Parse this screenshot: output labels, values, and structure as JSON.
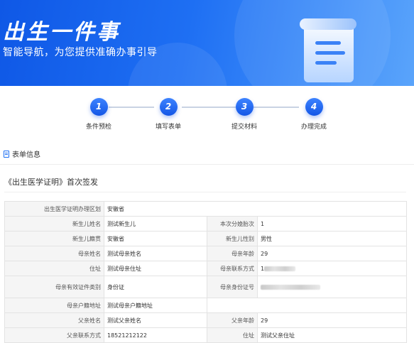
{
  "banner": {
    "title": "出生一件事",
    "subtitle": "智能导航，为您提供准确办事引导"
  },
  "steps": [
    {
      "num": "1",
      "label": "条件预检"
    },
    {
      "num": "2",
      "label": "填写表单"
    },
    {
      "num": "3",
      "label": "提交材料"
    },
    {
      "num": "4",
      "label": "办理完成"
    }
  ],
  "section": {
    "title": "表单信息",
    "form_title": "《出生医学证明》首次签发"
  },
  "table": {
    "region_label": "出生医学证明办理区划",
    "region_value": "安徽省",
    "newborn_name_label": "新生儿姓名",
    "newborn_name": "测试新生儿",
    "birth_order_label": "本次分娩胎次",
    "birth_order": "1",
    "newborn_origin_label": "新生儿籍贯",
    "newborn_origin": "安徽省",
    "newborn_gender_label": "新生儿性别",
    "newborn_gender": "男性",
    "mother_name_label": "母亲姓名",
    "mother_name": "测试母亲姓名",
    "mother_age_label": "母亲年龄",
    "mother_age": "29",
    "address_label": "住址",
    "address": "测试母亲住址",
    "mother_contact_label": "母亲联系方式",
    "mother_contact_visible": "1",
    "mother_id_type_label": "母亲有效证件类别",
    "mother_id_type": "身份证",
    "mother_id_number_label": "母亲身份证号",
    "mother_hukou_label": "母亲户籍地址",
    "mother_hukou": "测试母亲户籍地址",
    "father_name_label": "父亲姓名",
    "father_name": "测试父亲姓名",
    "father_age_label": "父亲年龄",
    "father_age": "29",
    "father_contact_label": "父亲联系方式",
    "father_contact": "18521212122",
    "father_address_label": "住址",
    "father_address": "测试父亲住址"
  },
  "colors": {
    "primary": "#1e6ff3",
    "banner_start": "#0f58e6",
    "banner_end": "#5aa4fb"
  }
}
